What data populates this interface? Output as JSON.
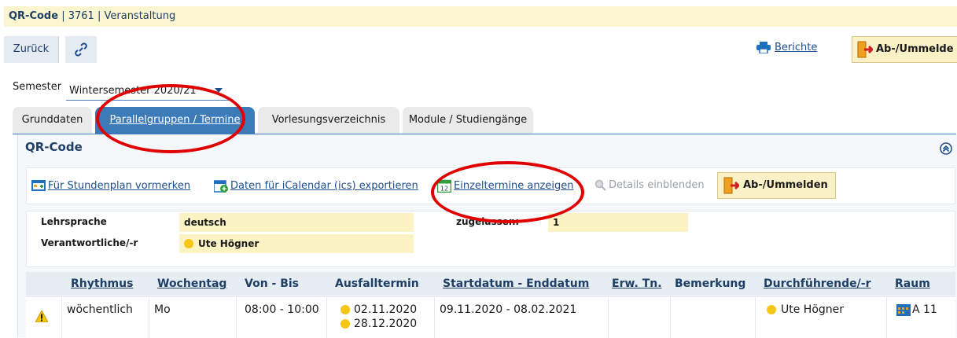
{
  "titlebar": {
    "label": "QR-Code",
    "sep1": "|",
    "number": "3761",
    "sep2": "|",
    "type": "Veranstaltung"
  },
  "toolbar": {
    "back": "Zurück",
    "reports": "Berichte",
    "enroll": "Ab-/Ummelde"
  },
  "semester": {
    "label": "Semester",
    "value": "Wintersemester 2020/21"
  },
  "tabs": [
    {
      "label": "Grunddaten"
    },
    {
      "label": "Parallelgruppen / Termine"
    },
    {
      "label": "Vorlesungsverzeichnis"
    },
    {
      "label": "Module / Studiengänge"
    }
  ],
  "section": {
    "title": "QR-Code"
  },
  "actions": {
    "schedule": "Für Stundenplan vormerken",
    "ical": "Daten für iCalendar (ics) exportieren",
    "single": "Einzeltermine anzeigen",
    "details": "Details einblenden",
    "enroll": "Ab-/Ummelden"
  },
  "info": {
    "language_label": "Lehrsprache",
    "language_value": "deutsch",
    "admitted_label": "zugelassen:",
    "admitted_value": "1",
    "responsible_label": "Verantwortliche/-r",
    "responsible_value": "Ute Högner"
  },
  "table": {
    "headers": {
      "rhythm": "Rhythmus",
      "weekday": "Wochentag",
      "time": "Von - Bis",
      "cancel": "Ausfalltermin",
      "dates": "Startdatum - Enddatum",
      "expected": "Erw. Tn.",
      "remark": "Bemerkung",
      "lecturer": "Durchführende/-r",
      "room": "Raum"
    },
    "rows": [
      {
        "rhythm": "wöchentlich",
        "weekday": "Mo",
        "time": "08:00 - 10:00",
        "cancel1": "02.11.2020",
        "cancel2": "28.12.2020",
        "dates": "09.11.2020 - 08.02.2021",
        "lecturer": "Ute Högner",
        "room": "A 11"
      }
    ]
  },
  "colors": {
    "accent": "#3d7ab8",
    "annotation": "#e10000",
    "highlight": "#fbf3c4"
  }
}
